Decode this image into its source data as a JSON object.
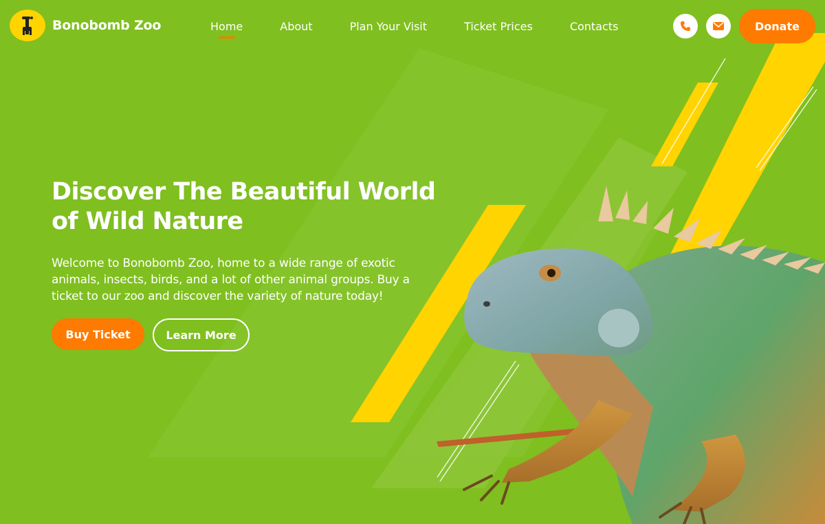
{
  "brand": {
    "name": "Bonobomb Zoo"
  },
  "nav": {
    "items": [
      {
        "label": "Home",
        "active": true
      },
      {
        "label": "About"
      },
      {
        "label": "Plan Your Visit"
      },
      {
        "label": "Ticket Prices"
      },
      {
        "label": "Contacts"
      }
    ]
  },
  "header_actions": {
    "phone_icon": "phone-icon",
    "mail_icon": "mail-icon",
    "donate_label": "Donate"
  },
  "hero": {
    "title": "Discover The Beautiful World of Wild Nature",
    "text": "Welcome to Bonobomb Zoo, home to a wide range of exotic animals, insects, birds, and a lot of other animal groups. Buy a ticket to our zoo and discover the variety of nature today!",
    "buy_label": "Buy Ticket",
    "learn_label": "Learn More"
  },
  "colors": {
    "background": "#7fbf1f",
    "accent": "#ff7a00",
    "stripe": "#ffd400",
    "logo_badge": "#ffd400"
  }
}
